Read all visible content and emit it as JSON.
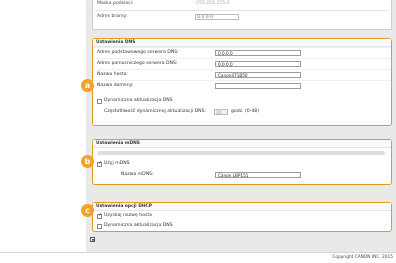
{
  "top": {
    "subnet_label": "Maska podsieci:",
    "subnet_value": "255.255.255.0",
    "gateway_label": "Adres bramy:",
    "gateway_value": "0.0.0.0"
  },
  "dns": {
    "title": "Ustawienia DNS",
    "primary_label": "Adres podstawowego serwera DNS:",
    "primary_value": "0.0.0.0",
    "secondary_label": "Adres pomocniczego serwera DNS:",
    "secondary_value": "0.0.0.0",
    "host_label": "Nazwa hosta:",
    "host_value": "Canon471B50",
    "domain_label": "Nazwa domeny:",
    "domain_value": "",
    "dynamic_label": "Dynamiczna aktualizacja DNS",
    "dynamic_checked": false,
    "interval_label": "Częstotliwość dynamicznej aktualizacji DNS:",
    "interval_value": "24",
    "interval_units": "godz. (0-48)"
  },
  "mdns": {
    "title": "Ustawienia mDNS",
    "use_label": "Użyj mDNS",
    "use_checked": true,
    "name_label": "Nazwa mDNS:",
    "name_value": "Canon LBP151"
  },
  "dhcp": {
    "title": "Ustawienia opcji DHCP",
    "host_label": "Uzyskaj nazwę hosta",
    "host_checked": true,
    "dyn_label": "Dynamiczna aktualizacja DNS",
    "dyn_checked": false
  },
  "badges": {
    "a": "a",
    "b": "b",
    "c": "c"
  },
  "colors": {
    "accent": "#f0a22a",
    "border": "#e39a1d"
  },
  "footer": {
    "copyright": "Copyright CANON INC. 2015"
  }
}
